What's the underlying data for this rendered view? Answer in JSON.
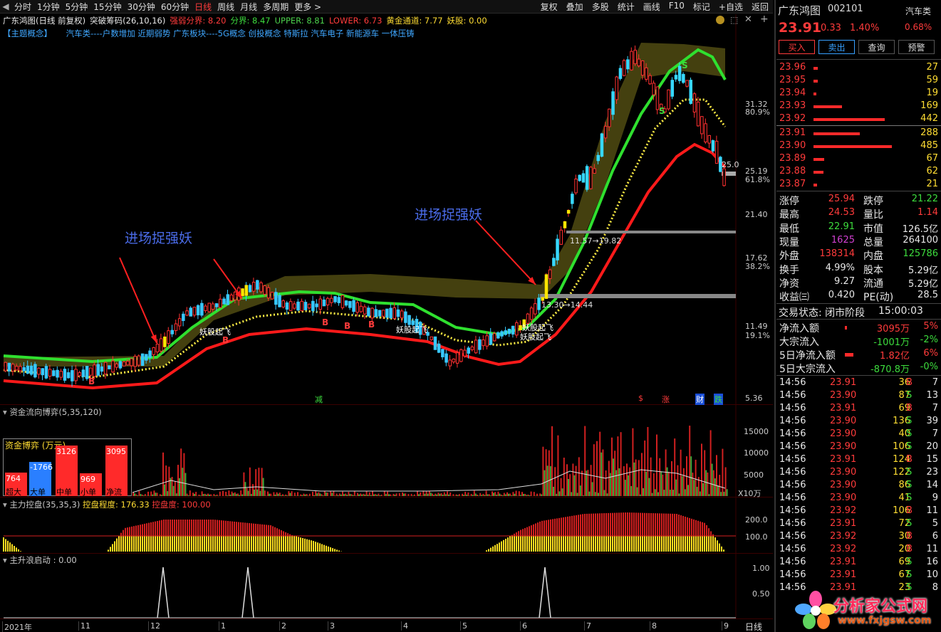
{
  "toolbar": {
    "periods": [
      "分时",
      "1分钟",
      "5分钟",
      "15分钟",
      "30分钟",
      "60分钟",
      "日线",
      "周线",
      "月线",
      "多周期",
      "更多 >"
    ],
    "active": "日线",
    "tools": [
      "复权",
      "叠加",
      "多股",
      "统计",
      "画线",
      "F10",
      "标记",
      "+自选",
      "返回"
    ]
  },
  "infobar": {
    "chart_name": "广东鸿图(日线 前复权)",
    "indicator": "突破筹码(26,10,16)",
    "strong_weak": "强弱分界: 8.20",
    "divide": "分界: 8.47",
    "upper": "UPPER: 8.81",
    "lower": "LOWER: 6.73",
    "gold_channel": "黄金通道: 7.77",
    "demon": "妖股: 0.00"
  },
  "concept": {
    "label": "【主题概念】",
    "text": "汽车类----户数增加 近期弱势 广东板块----5G概念 创投概念 特斯拉 汽车电子 新能源车 一体压铸"
  },
  "main_chart": {
    "price_labels": [
      "31.32",
      "80.9%",
      "25.19",
      "61.8%",
      "21.40",
      "17.62",
      "38.2%",
      "11.49",
      "19.1%",
      "5.36"
    ],
    "annotation_1": "进场捉强妖",
    "annotation_2": "进场捉强妖",
    "demon_labels": [
      "妖股起飞",
      "妖股起飞",
      "妖股起飞"
    ],
    "range_1": "11.57→19.82",
    "range_2": "13.30→14.44",
    "price_tag": "25.0",
    "bottom_markers": [
      "减",
      "$",
      "涨",
      "财",
      "跌"
    ]
  },
  "money_panel": {
    "title": "资金流向博弈(5,35,120)",
    "box_title": "资金博弈 (万元)",
    "bars": [
      {
        "label": "超大",
        "value": "764"
      },
      {
        "label": "大单",
        "value": "-1766"
      },
      {
        "label": "中单",
        "value": "3126"
      },
      {
        "label": "小单",
        "value": "969"
      },
      {
        "label": "净流",
        "value": "3095"
      }
    ],
    "y_labels": [
      "15000",
      "10000",
      "5000",
      "X10万"
    ]
  },
  "control_panel": {
    "title": "主力控盘(35,35,3)",
    "degree": "控盘程度: 176.33",
    "ctrl": "控盘度: 100.00",
    "y_labels": [
      "200.0",
      "100.0"
    ]
  },
  "launch_panel": {
    "title": "主升浪启动 : 0.00",
    "y_labels": [
      "1.00",
      "0.50"
    ]
  },
  "xaxis": {
    "labels": [
      "2021年",
      "11",
      "12",
      "1",
      "2",
      "3",
      "4",
      "5",
      "6",
      "7",
      "8",
      "9"
    ],
    "period": "日线"
  },
  "side": {
    "name": "广东鸿图",
    "code": "002101",
    "sector": "汽车类",
    "price": "23.91",
    "change": "0.33",
    "change_pct": "1.40%",
    "sector_pct": "0.68%",
    "buttons": [
      "买入",
      "卖出",
      "查询",
      "预警"
    ],
    "asks": [
      {
        "p": "23.96",
        "v": "27"
      },
      {
        "p": "23.95",
        "v": "59"
      },
      {
        "p": "23.94",
        "v": "19"
      },
      {
        "p": "23.93",
        "v": "169"
      },
      {
        "p": "23.92",
        "v": "442"
      }
    ],
    "bids": [
      {
        "p": "23.91",
        "v": "288"
      },
      {
        "p": "23.90",
        "v": "485"
      },
      {
        "p": "23.89",
        "v": "67"
      },
      {
        "p": "23.88",
        "v": "62"
      },
      {
        "p": "23.87",
        "v": "21"
      }
    ],
    "stats": [
      [
        "涨停",
        "25.94",
        "跌停",
        "21.22"
      ],
      [
        "最高",
        "24.53",
        "量比",
        "1.14"
      ],
      [
        "最低",
        "22.91",
        "市值",
        "126.5亿"
      ],
      [
        "现量",
        "1625",
        "总量",
        "264100"
      ],
      [
        "外盘",
        "138314",
        "内盘",
        "125786"
      ],
      [
        "换手",
        "4.99%",
        "股本",
        "5.29亿"
      ],
      [
        "净资",
        "9.27",
        "流通",
        "5.29亿"
      ],
      [
        "收益㈢",
        "0.420",
        "PE(动)",
        "28.5"
      ]
    ],
    "trade_state_label": "交易状态: 闭市阶段",
    "trade_state_time": "15:00:03",
    "flows": [
      {
        "label": "净流入额",
        "value": "3095万",
        "pct": "5%"
      },
      {
        "label": "大宗流入",
        "value": "-1001万",
        "pct": "-2%"
      },
      {
        "label": "5日净流入额",
        "value": "1.82亿",
        "pct": "6%"
      },
      {
        "label": "5日大宗流入",
        "value": "-870.8万",
        "pct": "-0%"
      }
    ],
    "ticks": [
      [
        "14:56",
        "23.91",
        "36",
        "B",
        "7"
      ],
      [
        "14:56",
        "23.90",
        "87",
        "S",
        "13"
      ],
      [
        "14:56",
        "23.91",
        "69",
        "B",
        "7"
      ],
      [
        "14:56",
        "23.90",
        "136",
        "S",
        "39"
      ],
      [
        "14:56",
        "23.90",
        "40",
        "S",
        "7"
      ],
      [
        "14:56",
        "23.90",
        "106",
        "S",
        "20"
      ],
      [
        "14:56",
        "23.91",
        "124",
        "B",
        "15"
      ],
      [
        "14:56",
        "23.90",
        "122",
        "S",
        "23"
      ],
      [
        "14:56",
        "23.90",
        "86",
        "S",
        "14"
      ],
      [
        "14:56",
        "23.90",
        "41",
        "S",
        "9"
      ],
      [
        "14:56",
        "23.92",
        "106",
        "B",
        "11"
      ],
      [
        "14:56",
        "23.91",
        "72",
        "S",
        "5"
      ],
      [
        "14:56",
        "23.92",
        "30",
        "B",
        "6"
      ],
      [
        "14:56",
        "23.92",
        "20",
        "B",
        "11"
      ],
      [
        "14:56",
        "23.91",
        "69",
        "S",
        "16"
      ],
      [
        "14:56",
        "23.91",
        "67",
        "S",
        "10"
      ],
      [
        "14:56",
        "23.91",
        "23",
        "S",
        "8"
      ]
    ]
  },
  "watermark": {
    "name": "分析家公式网",
    "url": "www.fxjgsw.com"
  },
  "colors": {
    "up": "#ff3b3b",
    "down": "#37c8ff",
    "line_green": "#2fe02f",
    "line_red": "#ff1a1a",
    "band": "#5a5416"
  }
}
